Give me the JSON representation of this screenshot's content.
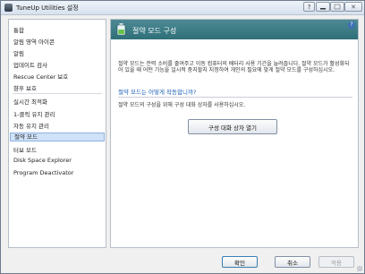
{
  "window": {
    "title": "TuneUp Utilities 설정"
  },
  "controls": {
    "help": "?",
    "close": "✕"
  },
  "sidebar": {
    "items": [
      {
        "label": "통합",
        "id": "general"
      },
      {
        "label": "알림 영역 아이콘",
        "id": "tray-icon"
      },
      {
        "label": "알림",
        "id": "notifications"
      },
      {
        "label": "업데이트 검사",
        "id": "update-check"
      },
      {
        "label": "Rescue Center 보호",
        "id": "rescue-center"
      },
      {
        "label": "향후 보호",
        "id": "future-protection"
      },
      {
        "label": "실시간 최적화",
        "id": "live-optimization"
      },
      {
        "label": "1-클릭 유지 관리",
        "id": "one-click-maintenance"
      },
      {
        "label": "자동 유지 관리",
        "id": "auto-maintenance"
      },
      {
        "label": "절약 모드",
        "id": "economy-mode"
      },
      {
        "label": "터보 모드",
        "id": "turbo-mode"
      },
      {
        "label": "Disk Space Explorer",
        "id": "disk-space-explorer"
      },
      {
        "label": "Program Deactivator",
        "id": "program-deactivator"
      }
    ],
    "selected_index": 9
  },
  "content": {
    "title": "절약 모드 구성",
    "description": "절약 모드는 전력 소비를 줄여주고 이동 컴퓨터의 배터리 사용 기간을 늘려줍니다. 절약 모드가 활성화되어 있을 때 어떤 기능을 일시적 중지할지 지정하여 개인의 필요에 맞게 절약 모드를 구성하십시오.",
    "link": "절약 모드는 어떻게 작동합니까?",
    "instruction": "절약 모드의 구성을 위해 구성 대화 상자를 사용하십시오.",
    "open_button": "구성 대화 상자 열기",
    "help": "?"
  },
  "footer": {
    "ok": "확인",
    "cancel": "취소",
    "apply": "적용"
  },
  "colors": {
    "header": "#3a7a84",
    "selection": "#cfe2f7",
    "link": "#1a5fb4"
  }
}
